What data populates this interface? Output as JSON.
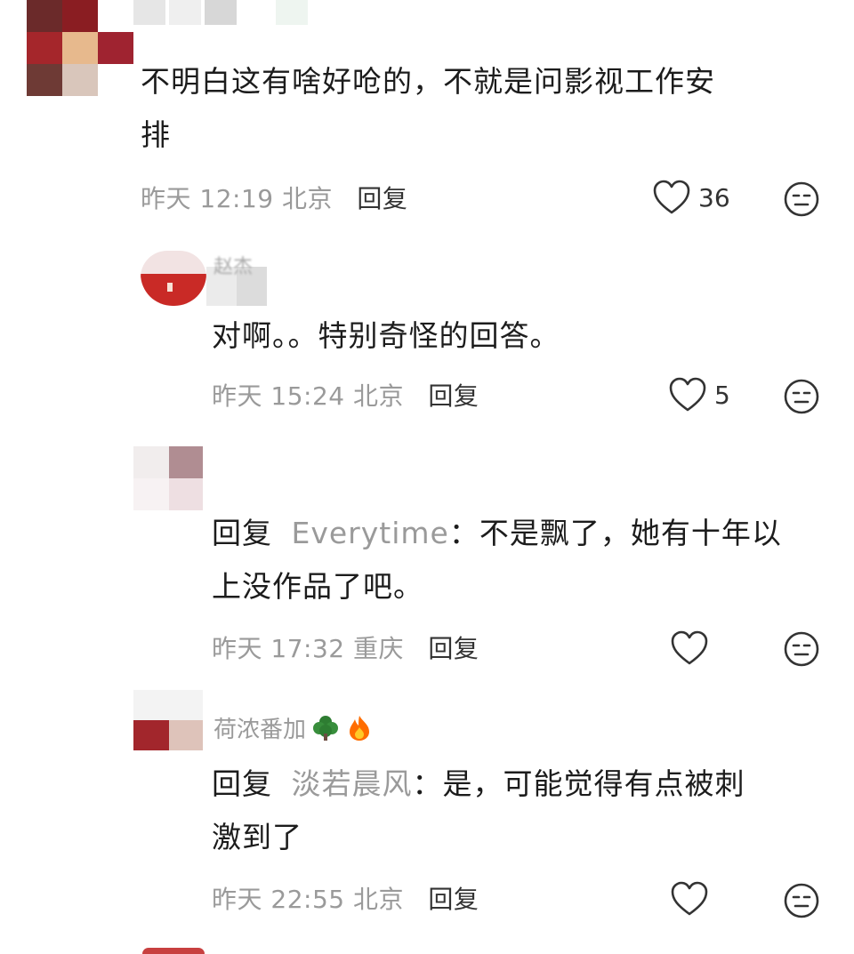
{
  "comments": [
    {
      "text_line1": "不明白这有啥好呛的，不就是问影视工作安",
      "text_line2": "排",
      "time": "昨天 12:19 北京",
      "reply_label": "回复",
      "likes": "36"
    },
    {
      "username": "赵杰",
      "text_line1": "对啊。。特别奇怪的回答。",
      "time": "昨天 15:24 北京",
      "reply_label": "回复",
      "likes": "5"
    },
    {
      "reply_prefix": "回复",
      "reply_target": "Everytime",
      "text_rest": "：不是飘了，她有十年以",
      "text_line2": "上没作品了吧。",
      "time": "昨天 17:32 重庆",
      "reply_label": "回复",
      "likes": ""
    },
    {
      "username": "荷浓番加",
      "reply_prefix": "回复",
      "reply_target": "淡若晨风",
      "text_rest": "：是，可能觉得有点被刺",
      "text_line2": "激到了",
      "time": "昨天 22:55 北京",
      "reply_label": "回复",
      "likes": ""
    }
  ],
  "icons": {
    "like": "heart-outline-icon",
    "emoji": "neutral-face-icon",
    "tree": "tree-emoji-icon",
    "fire": "fire-emoji-icon"
  },
  "colors": {
    "text": "#1c1c1c",
    "meta": "#9a9a9a",
    "icon": "#333333"
  }
}
